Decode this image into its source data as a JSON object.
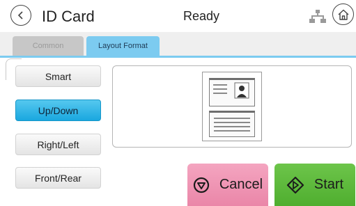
{
  "header": {
    "title": "ID Card",
    "status": "Ready"
  },
  "tabs": [
    {
      "label": "Common",
      "active": false
    },
    {
      "label": "Layout Format",
      "active": true
    }
  ],
  "layout_options": [
    {
      "label": "Smart",
      "selected": false
    },
    {
      "label": "Up/Down",
      "selected": true
    },
    {
      "label": "Right/Left",
      "selected": false
    },
    {
      "label": "Front/Rear",
      "selected": false
    }
  ],
  "actions": {
    "cancel_label": "Cancel",
    "start_label": "Start"
  },
  "icons": {
    "back": "back-arrow-icon",
    "network": "network-icon",
    "home": "home-icon",
    "cancel": "stop-icon",
    "start": "start-diamond-icon"
  },
  "colors": {
    "accent": "#7ccbf0",
    "selected_option": "#1aa7df",
    "cancel": "#ea86a8",
    "start": "#4fae2f"
  }
}
